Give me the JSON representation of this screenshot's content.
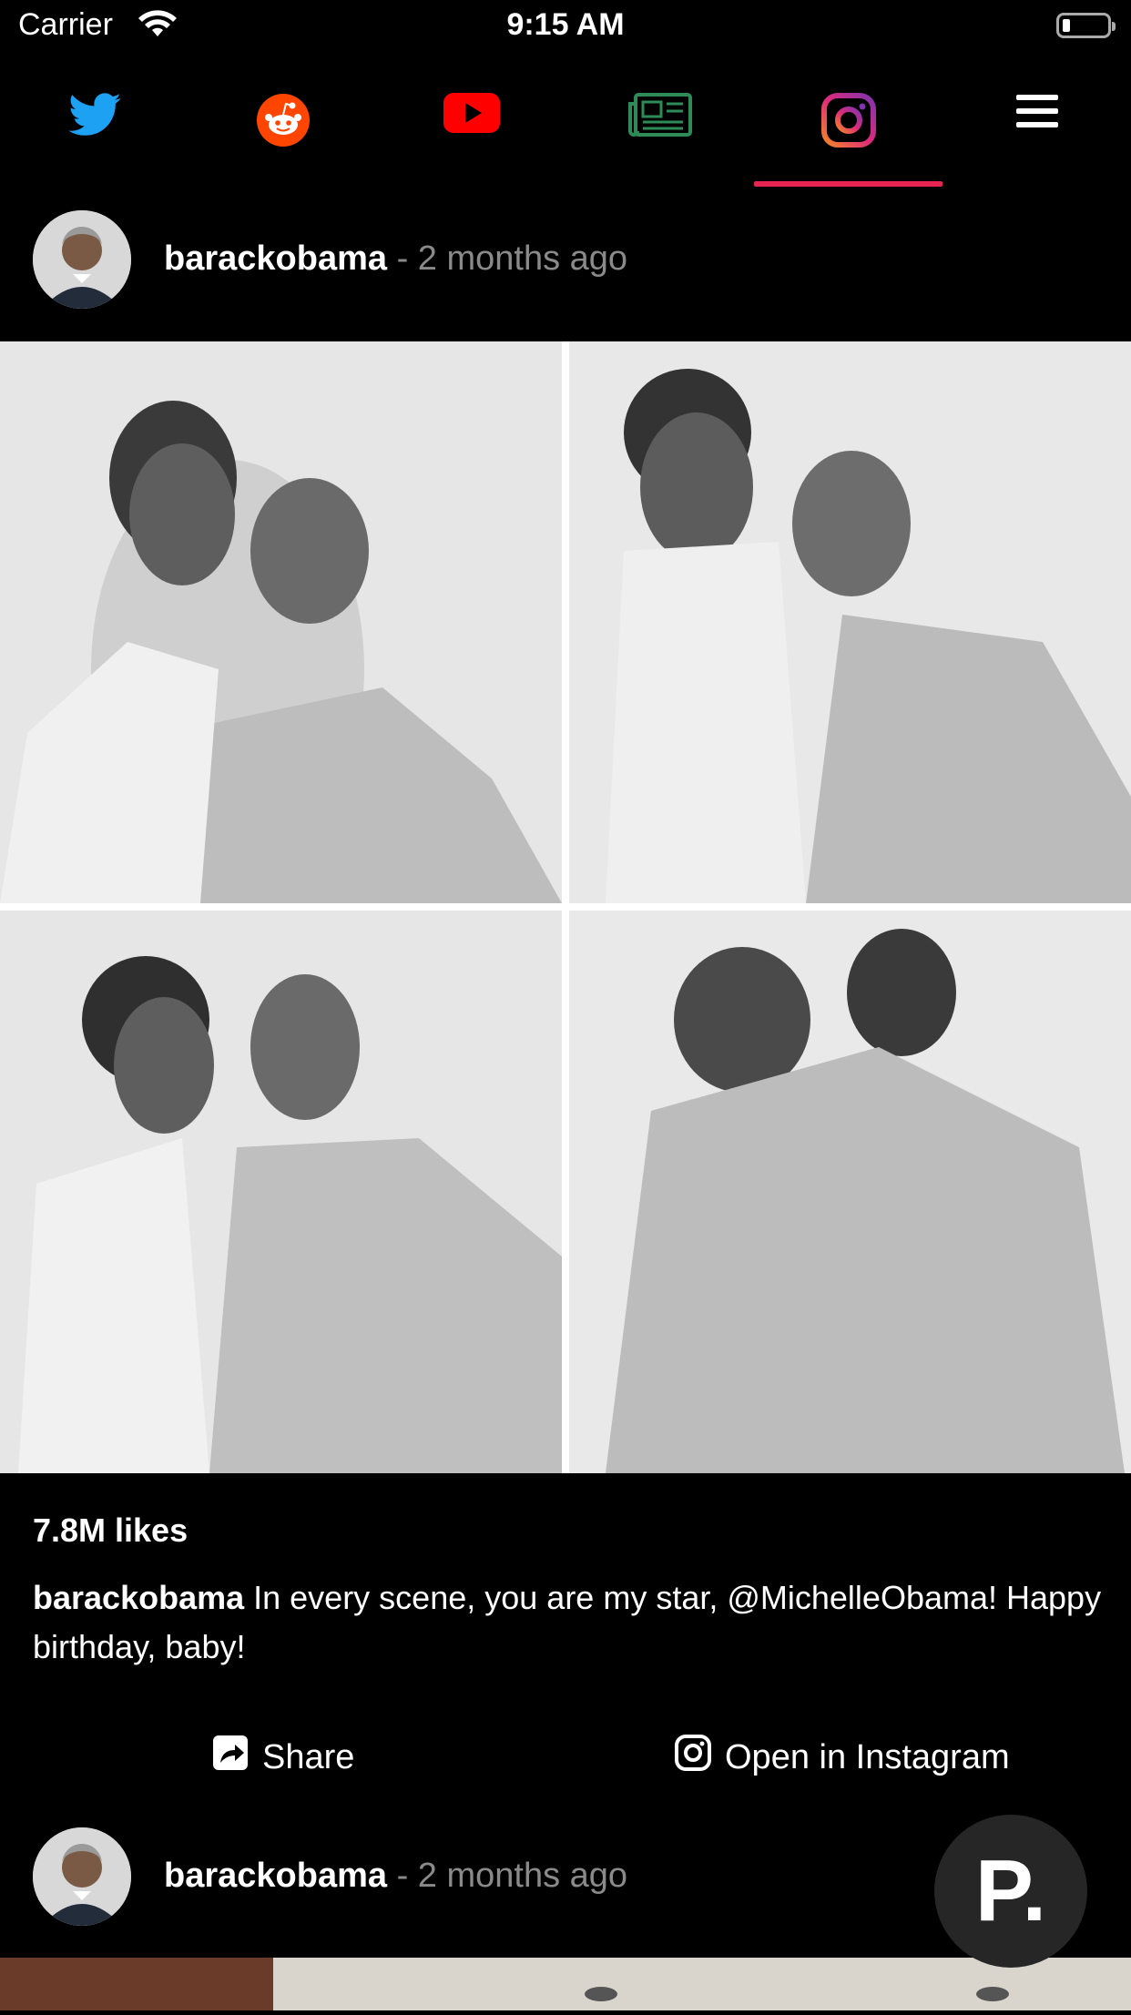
{
  "status_bar": {
    "carrier": "Carrier",
    "time": "9:15 AM"
  },
  "tabs": [
    {
      "name": "twitter-icon",
      "active": false
    },
    {
      "name": "reddit-icon",
      "active": false
    },
    {
      "name": "youtube-icon",
      "active": false
    },
    {
      "name": "news-icon",
      "active": false
    },
    {
      "name": "instagram-icon",
      "active": true
    },
    {
      "name": "menu-icon",
      "active": false
    }
  ],
  "colors": {
    "active_tab_underline": "#e5254f",
    "twitter": "#1da1f2",
    "reddit": "#ff4500",
    "youtube": "#ff0000",
    "news": "#2e8b57"
  },
  "posts": [
    {
      "username": "barackobama",
      "time_ago": " - 2 months ago",
      "likes": "7.8M likes",
      "caption_user": "barackobama",
      "caption_text": " In every scene, you are my star, @MichelleObama! Happy birthday, baby!",
      "share_label": "Share",
      "open_label": "Open in Instagram"
    },
    {
      "username": "barackobama",
      "time_ago": " - 2 months ago"
    }
  ],
  "fab": {
    "label": "P."
  }
}
